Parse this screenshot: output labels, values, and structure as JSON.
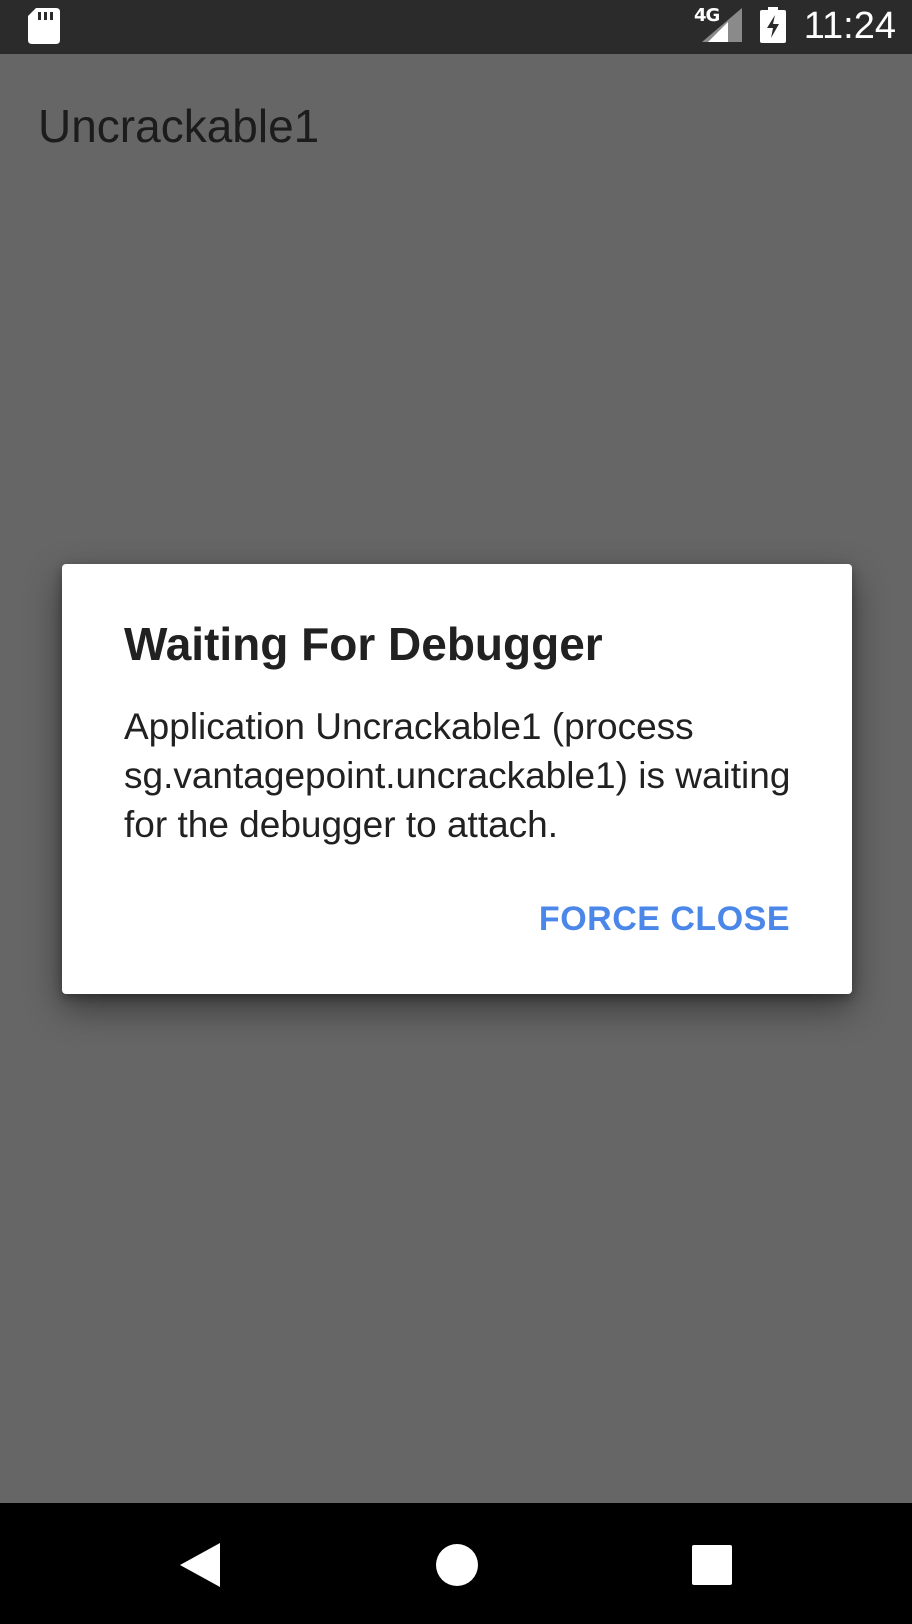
{
  "status_bar": {
    "network_type": "4G",
    "time": "11:24",
    "icons": [
      "sd-card-icon",
      "signal-icon",
      "battery-charging-icon"
    ]
  },
  "app": {
    "title": "Uncrackable1"
  },
  "dialog": {
    "title": "Waiting For Debugger",
    "message": "Application Uncrackable1 (process sg.vantagepoint.uncrackable1) is waiting for the debugger to attach.",
    "button_label": "FORCE CLOSE",
    "button_color": "#4b87e8"
  },
  "nav_bar": {
    "icons": [
      "back-icon",
      "home-icon",
      "recents-icon"
    ]
  },
  "colors": {
    "scrim_background": "#666666",
    "status_bar": "#2b2b2b",
    "nav_bar": "#000000",
    "dialog_background": "#ffffff"
  }
}
